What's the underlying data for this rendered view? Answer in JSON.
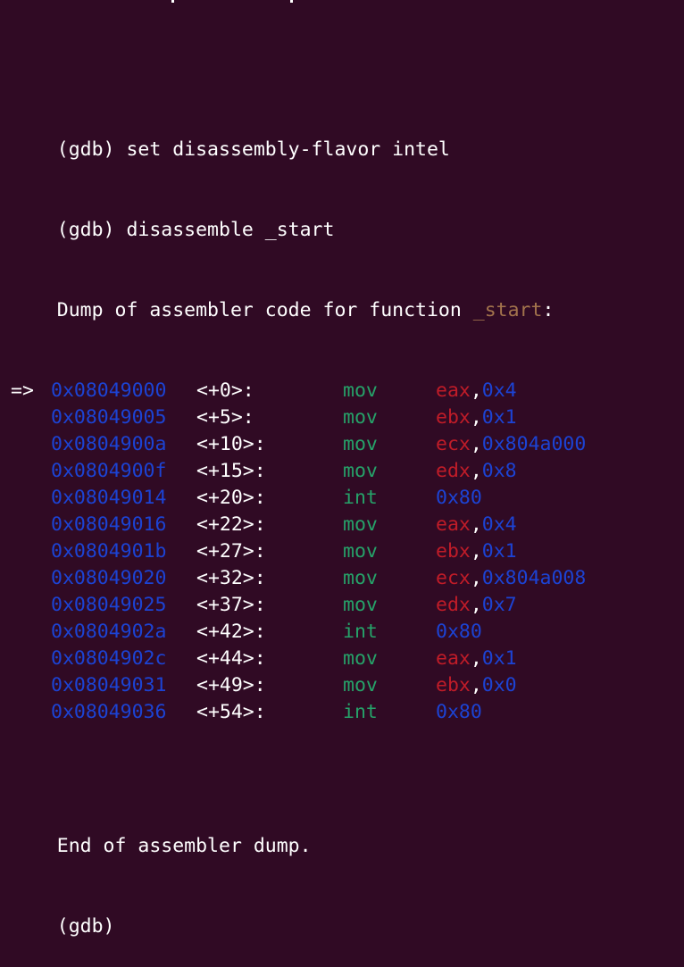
{
  "colors": {
    "background": "#300a24",
    "foreground": "#ffffff",
    "address": "#1c43d4",
    "mnemonic": "#26a269",
    "register": "#c01c28",
    "immediate": "#1c43d4",
    "function_name": "#a2734c"
  },
  "commands": [
    "(gdb) set disassembly-flavor intel",
    "(gdb) disassemble _start"
  ],
  "dump_header": {
    "prefix": "Dump of assembler code for function ",
    "function": "_start",
    "suffix": ":"
  },
  "current_marker": "=>",
  "instructions": [
    {
      "address": "0x08049000",
      "offset": "<+0>:",
      "mnemonic": "mov",
      "reg": "eax",
      "imm": "0x4"
    },
    {
      "address": "0x08049005",
      "offset": "<+5>:",
      "mnemonic": "mov",
      "reg": "ebx",
      "imm": "0x1"
    },
    {
      "address": "0x0804900a",
      "offset": "<+10>:",
      "mnemonic": "mov",
      "reg": "ecx",
      "imm": "0x804a000"
    },
    {
      "address": "0x0804900f",
      "offset": "<+15>:",
      "mnemonic": "mov",
      "reg": "edx",
      "imm": "0x8"
    },
    {
      "address": "0x08049014",
      "offset": "<+20>:",
      "mnemonic": "int",
      "reg": "",
      "imm": "0x80"
    },
    {
      "address": "0x08049016",
      "offset": "<+22>:",
      "mnemonic": "mov",
      "reg": "eax",
      "imm": "0x4"
    },
    {
      "address": "0x0804901b",
      "offset": "<+27>:",
      "mnemonic": "mov",
      "reg": "ebx",
      "imm": "0x1"
    },
    {
      "address": "0x08049020",
      "offset": "<+32>:",
      "mnemonic": "mov",
      "reg": "ecx",
      "imm": "0x804a008"
    },
    {
      "address": "0x08049025",
      "offset": "<+37>:",
      "mnemonic": "mov",
      "reg": "edx",
      "imm": "0x7"
    },
    {
      "address": "0x0804902a",
      "offset": "<+42>:",
      "mnemonic": "int",
      "reg": "",
      "imm": "0x80"
    },
    {
      "address": "0x0804902c",
      "offset": "<+44>:",
      "mnemonic": "mov",
      "reg": "eax",
      "imm": "0x1"
    },
    {
      "address": "0x08049031",
      "offset": "<+49>:",
      "mnemonic": "mov",
      "reg": "ebx",
      "imm": "0x0"
    },
    {
      "address": "0x08049036",
      "offset": "<+54>:",
      "mnemonic": "int",
      "reg": "",
      "imm": "0x80"
    }
  ],
  "dump_footer": "End of assembler dump.",
  "prompt": "(gdb)"
}
